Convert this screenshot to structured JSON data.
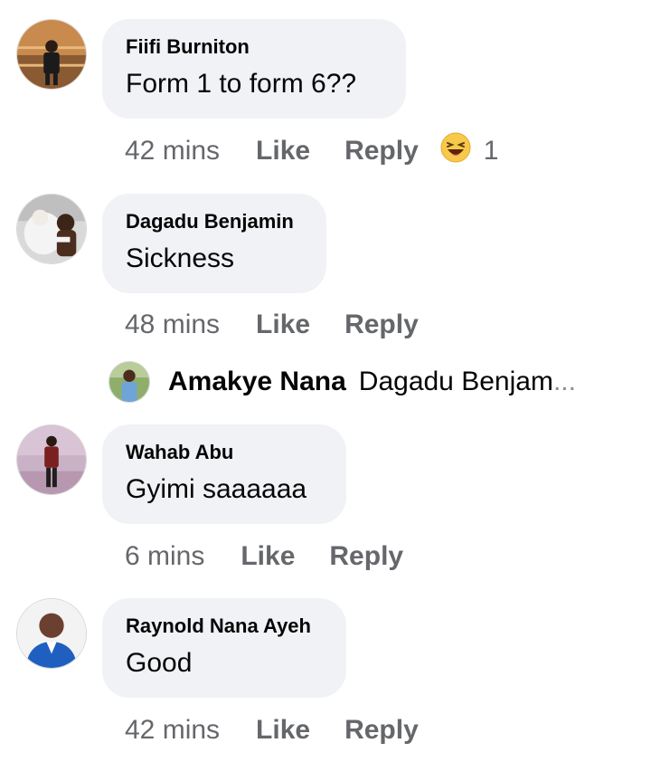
{
  "comments": [
    {
      "author": "Fiifi Burniton",
      "text": "Form 1 to form 6??",
      "time": "42 mins",
      "like": "Like",
      "reply": "Reply",
      "reaction": {
        "icon": "laughing-emoji-icon",
        "count": "1"
      }
    },
    {
      "author": "Dagadu Benjamin",
      "text": "Sickness",
      "time": "48 mins",
      "like": "Like",
      "reply": "Reply"
    },
    {
      "author": "Wahab Abu",
      "text": "Gyimi saaaaaa",
      "time": "6 mins",
      "like": "Like",
      "reply": "Reply"
    },
    {
      "author": "Raynold Nana Ayeh",
      "text": "Good",
      "time": "42 mins",
      "like": "Like",
      "reply": "Reply"
    }
  ],
  "reply_preview": {
    "author": "Amakye Nana",
    "text": "Dagadu Benjam",
    "ellipsis": "..."
  },
  "colors": {
    "bubble": "#f0f2f5",
    "meta_text": "#65676b",
    "text": "#050505"
  }
}
